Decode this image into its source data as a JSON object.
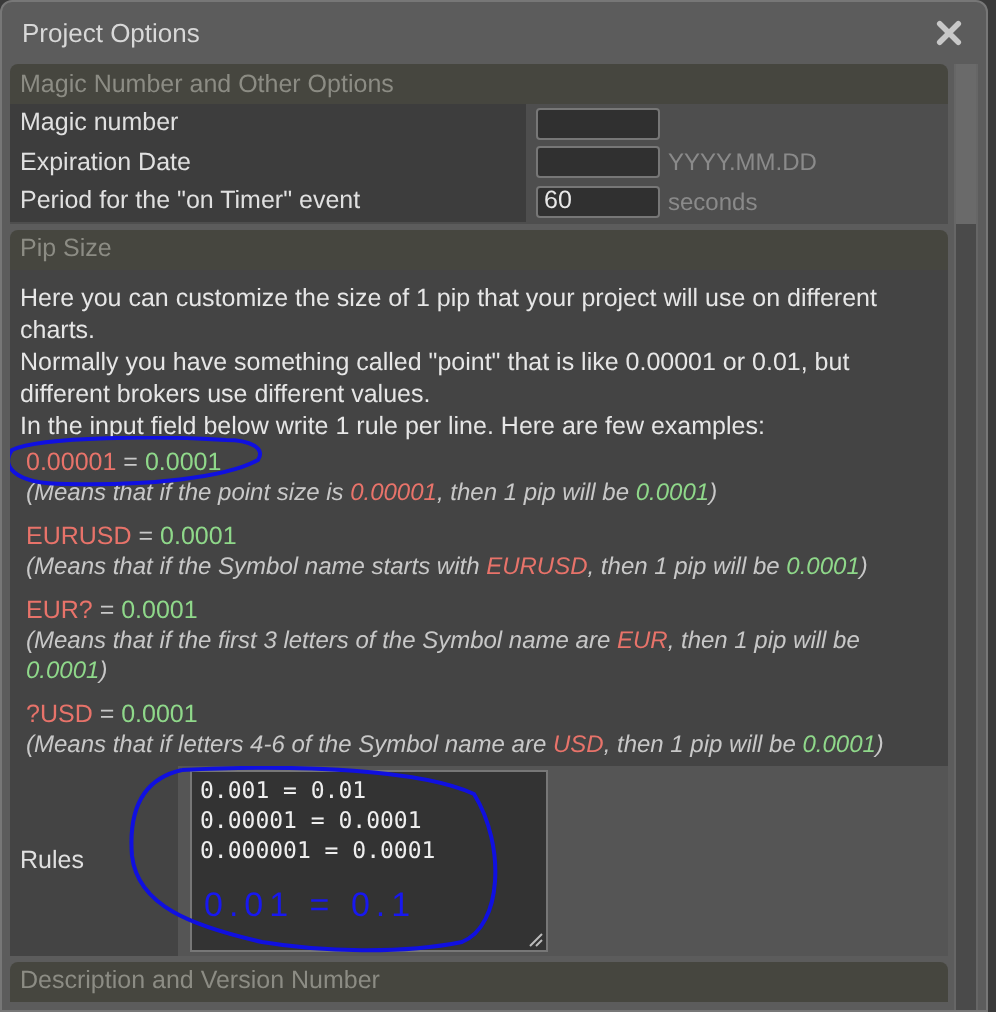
{
  "window": {
    "title": "Project Options"
  },
  "sections": [
    {
      "title": "Magic Number and Other Options",
      "kind": "fields",
      "fields": [
        {
          "label": "Magic number"
        },
        {
          "label": "Expiration Date",
          "hint": "YYYY.MM.DD"
        },
        {
          "label": "Period for the \"on Timer\" event",
          "value": "60",
          "hint": "seconds"
        }
      ]
    },
    {
      "title": "Pip Size",
      "kind": "pip",
      "intro": [
        "Here you can customize the size of 1 pip that your project will use on different charts.",
        "Normally you have something called \"point\" that is like 0.00001 or 0.01, but different brokers use different values.",
        "In the input field below write 1 rule per line. Here are few examples:"
      ],
      "examples": [
        {
          "circled": true,
          "rule": [
            {
              "text": "0.00001",
              "color": "#e8736a"
            },
            {
              "text": " = ",
              "color": "#c8c8c8"
            },
            {
              "text": "0.0001",
              "color": "#8fd88a"
            }
          ],
          "note": [
            {
              "text": "(Means that if the point size is ",
              "color": "#c8c8c8"
            },
            {
              "text": "0.00001",
              "color": "#e8736a"
            },
            {
              "text": ", then 1 pip will be ",
              "color": "#c8c8c8"
            },
            {
              "text": "0.0001",
              "color": "#8fd88a"
            },
            {
              "text": ")",
              "color": "#c8c8c8"
            }
          ]
        },
        {
          "circled": false,
          "rule": [
            {
              "text": "EURUSD",
              "color": "#e8736a"
            },
            {
              "text": " = ",
              "color": "#c8c8c8"
            },
            {
              "text": "0.0001",
              "color": "#8fd88a"
            }
          ],
          "note": [
            {
              "text": "(Means that if the Symbol name starts with ",
              "color": "#c8c8c8"
            },
            {
              "text": "EURUSD",
              "color": "#e8736a"
            },
            {
              "text": ", then 1 pip will be ",
              "color": "#c8c8c8"
            },
            {
              "text": "0.0001",
              "color": "#8fd88a"
            },
            {
              "text": ")",
              "color": "#c8c8c8"
            }
          ]
        },
        {
          "circled": false,
          "rule": [
            {
              "text": "EUR?",
              "color": "#e8736a"
            },
            {
              "text": " = ",
              "color": "#c8c8c8"
            },
            {
              "text": "0.0001",
              "color": "#8fd88a"
            }
          ],
          "note": [
            {
              "text": "(Means that if the first 3 letters of the Symbol name are ",
              "color": "#c8c8c8"
            },
            {
              "text": "EUR",
              "color": "#e8736a"
            },
            {
              "text": ", then 1 pip will be ",
              "color": "#c8c8c8"
            },
            {
              "text": "0.0001",
              "color": "#8fd88a"
            },
            {
              "text": ")",
              "color": "#c8c8c8"
            }
          ]
        },
        {
          "circled": false,
          "rule": [
            {
              "text": "?USD",
              "color": "#e8736a"
            },
            {
              "text": " = ",
              "color": "#c8c8c8"
            },
            {
              "text": "0.0001",
              "color": "#8fd88a"
            }
          ],
          "note": [
            {
              "text": "(Means that if letters 4-6 of the Symbol name are ",
              "color": "#c8c8c8"
            },
            {
              "text": "USD",
              "color": "#e8736a"
            },
            {
              "text": ", then 1 pip will be ",
              "color": "#c8c8c8"
            },
            {
              "text": "0.0001",
              "color": "#8fd88a"
            },
            {
              "text": ")",
              "color": "#c8c8c8"
            }
          ]
        }
      ],
      "rules": {
        "label": "Rules",
        "circled": true,
        "lines": [
          "0.001 = 0.01",
          "0.00001 = 0.0001",
          "0.000001 = 0.0001"
        ],
        "handwritten_note": "0.01 = 0.1"
      }
    },
    {
      "title": "Description and Version Number",
      "kind": "collapsed"
    }
  ]
}
